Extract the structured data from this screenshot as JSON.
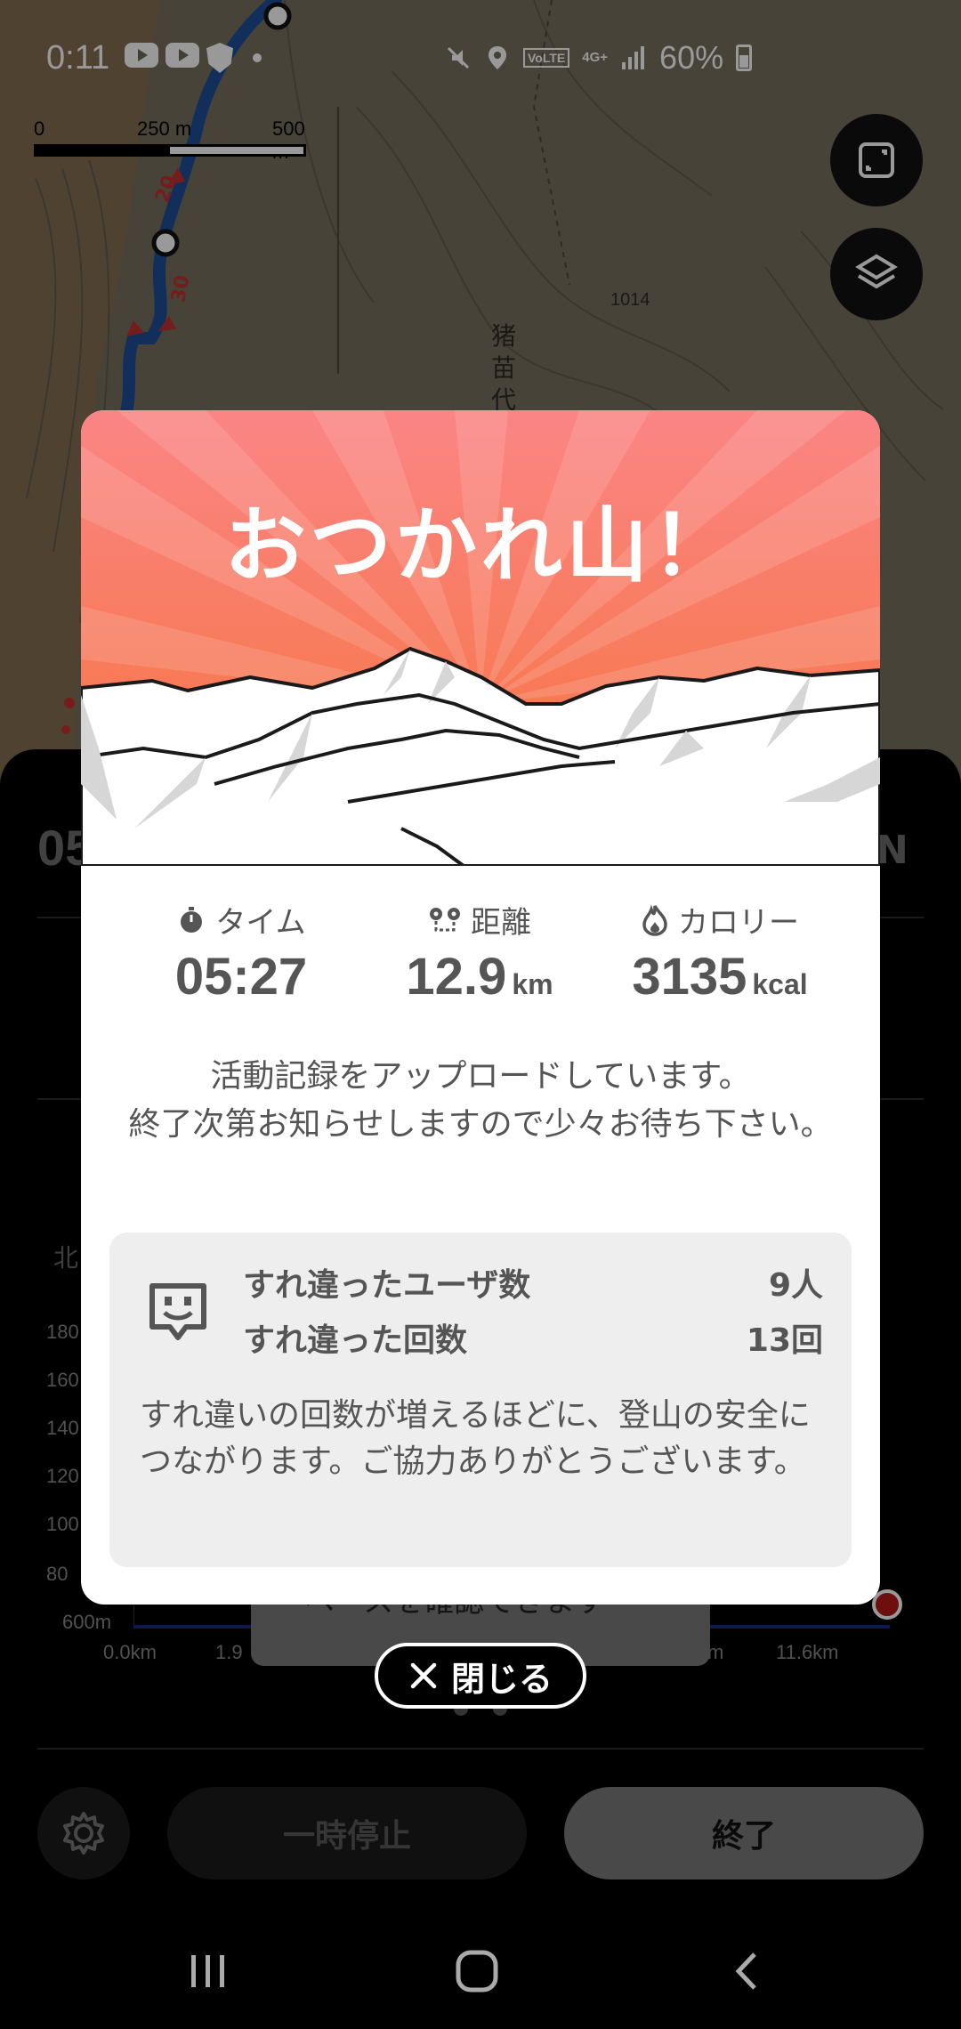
{
  "status_bar": {
    "time": "0:11",
    "network": "4G+",
    "volte": "VoLTE",
    "battery": "60%"
  },
  "map": {
    "scale_labels": [
      "0",
      "250 m",
      "500 m"
    ],
    "elevation_label": "1014",
    "place_label": "猪苗代",
    "route_markers": [
      "20",
      "30"
    ]
  },
  "map_controls": {
    "expand_icon": "expand-icon",
    "layers_icon": "layers-icon"
  },
  "sheet": {
    "time_partial": "05",
    "north_label": "N",
    "direction_label": "北",
    "y_ticks": [
      "180",
      "160",
      "140",
      "120",
      "100",
      "80",
      "600m"
    ],
    "x_ticks": [
      "0.0km",
      "1.9",
      "km",
      "11.6km"
    ],
    "tooltip_text": "ペースを確認できます",
    "pause_label": "一時停止",
    "end_label": "終了"
  },
  "modal": {
    "title": "おつかれ山！",
    "stats": [
      {
        "icon": "stopwatch-icon",
        "label": "タイム",
        "value": "05:27",
        "unit": ""
      },
      {
        "icon": "route-icon",
        "label": "距離",
        "value": "12.9",
        "unit": "km"
      },
      {
        "icon": "flame-icon",
        "label": "カロリー",
        "value": "3135",
        "unit": "kcal"
      }
    ],
    "upload_message": "活動記録をアップロードしています。\n終了次第お知らせしますので少々お待ち下さい。",
    "pass_stats": {
      "users_label": "すれ違ったユーザ数",
      "users_value": "9人",
      "count_label": "すれ違った回数",
      "count_value": "13回",
      "note": "すれ違いの回数が増えるほどに、登山の安全につながります。ご協力ありがとうございます。"
    },
    "colors": {
      "hero_top": "#fa8585",
      "hero_bottom": "#f7733a",
      "panel_bg": "#eeeeee"
    }
  },
  "close_button": {
    "label": "閉じる"
  }
}
